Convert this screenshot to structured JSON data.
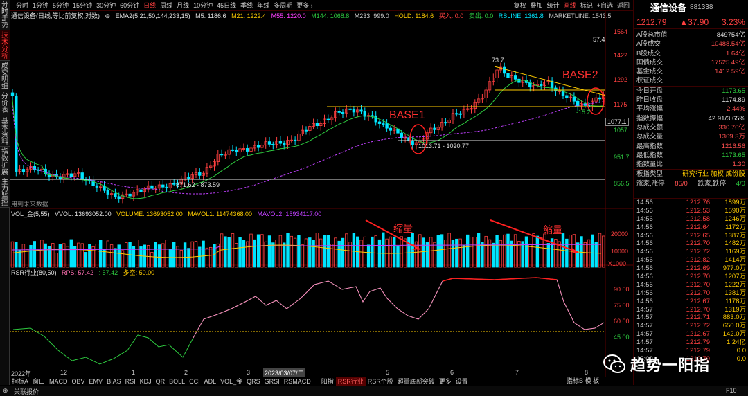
{
  "left_tabs": [
    {
      "label": "分时走势",
      "active": false
    },
    {
      "label": "技术分析",
      "active": true
    },
    {
      "label": "成交明细",
      "active": false
    },
    {
      "label": "分价表",
      "active": false
    },
    {
      "label": "基本资料",
      "active": false
    },
    {
      "label": "指数扩展",
      "active": false
    },
    {
      "label": "主力监控",
      "active": false
    }
  ],
  "periods": [
    "分时",
    "1分钟",
    "5分钟",
    "15分钟",
    "30分钟",
    "60分钟",
    "日线",
    "周线",
    "月线",
    "10分钟",
    "45日线",
    "季线",
    "年线",
    "多周期",
    "更多 ›"
  ],
  "selected_period": "日线",
  "toolbar": [
    "复权",
    "叠加",
    "统计",
    "画线",
    "标记",
    "+自选",
    "返回"
  ],
  "toolbar_selected": "画线",
  "main_legend": {
    "stock": "通信设备(日线,等比前复权,对数)",
    "ema_name": "EMA2(5,21,50,144,233,15)",
    "m5": "M5: 1186.6",
    "m21": "M21: 1222.4",
    "m55": "M55: 1220.0",
    "m144": "M144: 1068.8",
    "m233": "M233: 999.0",
    "hold": "HOLD: 1184.6",
    "buy": "买入: 0.0",
    "sell": "卖出: 0.0",
    "rsline": "RSLINE: 1361.8",
    "marketline": "MARKETLINE: 1543.5"
  },
  "price_axis": [
    "1564",
    "1422",
    "1292",
    "1175",
    "1057",
    "951.7",
    "856.5"
  ],
  "price_tag": "1077.1",
  "chart_annotations": {
    "peak": "73.7",
    "top_right": "57.4",
    "low1": "1013.71 - 1020.77",
    "low0": "871.62 - 873.59",
    "dip": "-15.2",
    "base1": "BASE1",
    "base2": "BASE2",
    "no_future": "用到未来数据"
  },
  "vol_legend": {
    "name": "VOL_金(5,55)",
    "vvol": "VVOL: 13693052.00",
    "volume": "VOLUME: 13693052.00",
    "mavol1": "MAVOL1: 11474368.00",
    "mavol2": "MAVOL2: 15934117.00",
    "shrink1": "缩量",
    "shrink2": "缩量"
  },
  "vol_axis": [
    "20000",
    "10000",
    "X1000"
  ],
  "rsr_legend": {
    "name": "RSR行业(80,50)",
    "rps": "RPS: 57.42",
    "rps2": ": 57.42",
    "duokong": "多空: 50.00"
  },
  "rsr_axis": [
    "90.00",
    "75.00",
    "60.00",
    "45.00"
  ],
  "date_axis": [
    "2022年",
    "12",
    "1",
    "2",
    "3",
    "2023/03/07/二",
    "5",
    "6",
    "7",
    "8"
  ],
  "bottom_tabs": [
    "指标A",
    "窗口",
    "MACD",
    "OBV",
    "EMV",
    "BIAS",
    "RSI",
    "KDJ",
    "QR",
    "BOLL",
    "CCI",
    "ADL",
    "VOL_金",
    "QRS",
    "GRSI",
    "RSMACD",
    "一阳指",
    "RSR行业",
    "RSR个股",
    "超量底部突破",
    "更多",
    "设置"
  ],
  "bottom_selected": "RSR行业",
  "bottom_right": [
    "指标B",
    "模",
    "板"
  ],
  "status": {
    "left": "关联报价",
    "right": "F10"
  },
  "quote": {
    "name": "通信设备",
    "code": "881338",
    "price": "1212.79",
    "change": "▲37.90",
    "pct": "3.23%"
  },
  "stats_top": [
    {
      "k": "A股总市值",
      "v": "849754亿",
      "c": "w"
    },
    {
      "k": "A股成交",
      "v": "10488.54亿",
      "c": "r"
    },
    {
      "k": "B股成交",
      "v": "1.64亿",
      "c": "r"
    },
    {
      "k": "国债成交",
      "v": "17525.49亿",
      "c": "r"
    },
    {
      "k": "基金成交",
      "v": "1412.59亿",
      "c": "r"
    },
    {
      "k": "权证成交",
      "v": "",
      "c": "r"
    }
  ],
  "stats_mid": [
    {
      "k": "今日开盘",
      "v": "1173.65",
      "c": "g"
    },
    {
      "k": "昨日收盘",
      "v": "1174.89",
      "c": "w"
    },
    {
      "k": "平均涨幅",
      "v": "2.44%",
      "c": "r"
    },
    {
      "k": "指数振幅",
      "v": "42.91/3.65%",
      "c": "w"
    },
    {
      "k": "总成交额",
      "v": "330.70亿",
      "c": "r"
    },
    {
      "k": "总成交量",
      "v": "1369.3万",
      "c": "r"
    },
    {
      "k": "最高指数",
      "v": "1216.56",
      "c": "r"
    },
    {
      "k": "最低指数",
      "v": "1173.65",
      "c": "g"
    },
    {
      "k": "指数量比",
      "v": "1.30",
      "c": "r"
    }
  ],
  "board": {
    "k": "板指类型",
    "v": "研究行业 加权 成份股"
  },
  "updown": {
    "up_label": "涨家,涨停",
    "up": "85/0",
    "down_label": "跌家,跌停",
    "down": "4/0"
  },
  "ticks": [
    {
      "t": "14:56",
      "p": "1212.76",
      "v": "1899万"
    },
    {
      "t": "14:56",
      "p": "1212.53",
      "v": "1590万"
    },
    {
      "t": "14:56",
      "p": "1212.58",
      "v": "1246万"
    },
    {
      "t": "14:56",
      "p": "1212.64",
      "v": "1172万"
    },
    {
      "t": "14:56",
      "p": "1212.65",
      "v": "1387万"
    },
    {
      "t": "14:56",
      "p": "1212.70",
      "v": "1482万"
    },
    {
      "t": "14:56",
      "p": "1212.72",
      "v": "1169万"
    },
    {
      "t": "14:56",
      "p": "1212.82",
      "v": "1414万"
    },
    {
      "t": "14:56",
      "p": "1212.69",
      "v": "977.0万"
    },
    {
      "t": "14:56",
      "p": "1212.70",
      "v": "1207万"
    },
    {
      "t": "14:56",
      "p": "1212.70",
      "v": "1222万"
    },
    {
      "t": "14:56",
      "p": "1212.70",
      "v": "1381万"
    },
    {
      "t": "14:56",
      "p": "1212.67",
      "v": "1178万"
    },
    {
      "t": "14:57",
      "p": "1212.70",
      "v": "1319万"
    },
    {
      "t": "14:57",
      "p": "1212.71",
      "v": "883.0万"
    },
    {
      "t": "14:57",
      "p": "1212.72",
      "v": "650.0万"
    },
    {
      "t": "14:57",
      "p": "1212.67",
      "v": "142.0万"
    },
    {
      "t": "14:57",
      "p": "1212.79",
      "v": "1.24亿"
    },
    {
      "t": "14:57",
      "p": "1212.79",
      "v": "0.0"
    },
    {
      "t": "15:00",
      "p": "1212.79",
      "v": "0.0"
    }
  ],
  "watermark": "趋势一阳指",
  "colors": {
    "up": "#ff4040",
    "down": "#00e5ff",
    "green": "#2ecc40",
    "yellow": "#ffcc00",
    "purple": "#c040ff",
    "bg": "#000000"
  }
}
